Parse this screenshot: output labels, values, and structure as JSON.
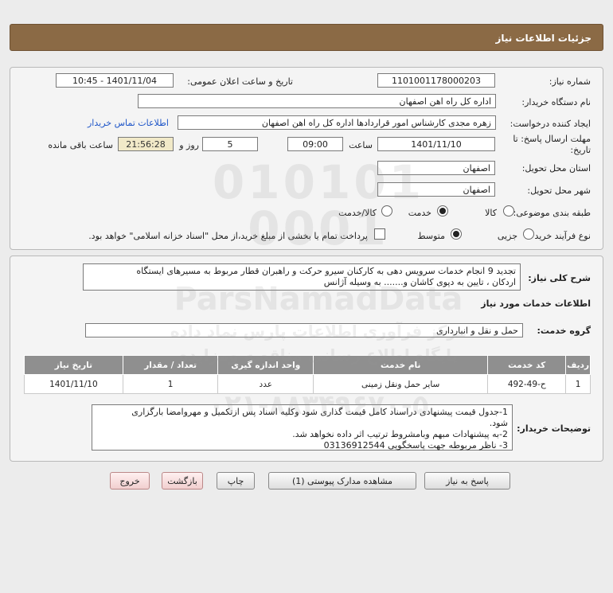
{
  "header": {
    "title": "جزئیات اطلاعات نیاز"
  },
  "form": {
    "need_number": {
      "label": "شماره نیاز:",
      "value": "1101001178000203"
    },
    "announce": {
      "label": "تاریخ و ساعت اعلان عمومی:",
      "value": "1401/11/04 - 10:45"
    },
    "buyer_org": {
      "label": "نام دستگاه خریدار:",
      "value": "اداره کل راه اهن اصفهان"
    },
    "requester": {
      "label": "ایجاد کننده درخواست:",
      "value": "زهره مجدی کارشناس امور قراردادها اداره کل راه اهن اصفهان",
      "link": "اطلاعات تماس خریدار"
    },
    "deadline": {
      "label_line1": "مهلت ارسال پاسخ: تا",
      "label_line2": "تاریخ:",
      "date": "1401/11/10",
      "time_label": "ساعت",
      "time": "09:00",
      "days": "5",
      "days_label": "روز و",
      "remaining": "21:56:28",
      "remaining_label": "ساعت باقی مانده"
    },
    "province": {
      "label": "استان محل تحویل:",
      "value": "اصفهان"
    },
    "city": {
      "label": "شهر محل تحویل:",
      "value": "اصفهان"
    },
    "category": {
      "label": "طبقه بندی موضوعی:",
      "options": [
        "کالا",
        "خدمت",
        "کالا/خدمت"
      ],
      "selected": "خدمت"
    },
    "purchase_type": {
      "label": "نوع فرآیند خرید :",
      "options": [
        "جزیی",
        "متوسط"
      ],
      "selected": "متوسط",
      "note": "پرداخت تمام یا بخشی از مبلغ خرید،از محل \"اسناد خزانه اسلامی\" خواهد بود."
    }
  },
  "summary": {
    "label": "شرح کلی نیاز:",
    "line1": "تجدید 9 انجام خدمات سرویس دهی  به کارکنان سیرو حرکت و راهبران قطار مربوط به مسیرهای  ایستگاه",
    "line2": "اردکان ، تایین به دپوی کاشان و....... به وسیله آژانس"
  },
  "services": {
    "title": "اطلاعات خدمات مورد نیاز",
    "group_label": "گروه خدمت:",
    "group_value": "حمل و نقل و انبارداری",
    "columns": [
      "ردیف",
      "کد خدمت",
      "نام خدمت",
      "واحد اندازه گیری",
      "تعداد / مقدار",
      "تاریخ نیاز"
    ],
    "rows": [
      [
        "1",
        "ح-49-492",
        "سایر حمل ونقل زمینی",
        "عدد",
        "1",
        "1401/11/10"
      ]
    ]
  },
  "notes": {
    "label": "توضیحات خریدار:",
    "line1": "1-جدول قیمت پیشنهادی دراسناد کامل قیمت گذاری شود وکلیه اسناد پس ازتکمیل و مهروامضا بارگزاری",
    "line2": "شود.",
    "line3": "2-به پیشنهادات مبهم وبامشروط ترتیب اثر داده نخواهد شد.",
    "line4": "3- ناظر مربوطه جهت پاسخگویی 03136912544"
  },
  "buttons": {
    "reply": "پاسخ به نیاز",
    "attachments": "مشاهده مدارک پیوستی (1)",
    "print": "چاپ",
    "back": "بازگشت",
    "exit": "خروج"
  },
  "colors": {
    "header": "#8b6a45",
    "table_head": "#8f8f8f",
    "link": "#1f56c8",
    "timer_bg": "#f1e9c8"
  }
}
